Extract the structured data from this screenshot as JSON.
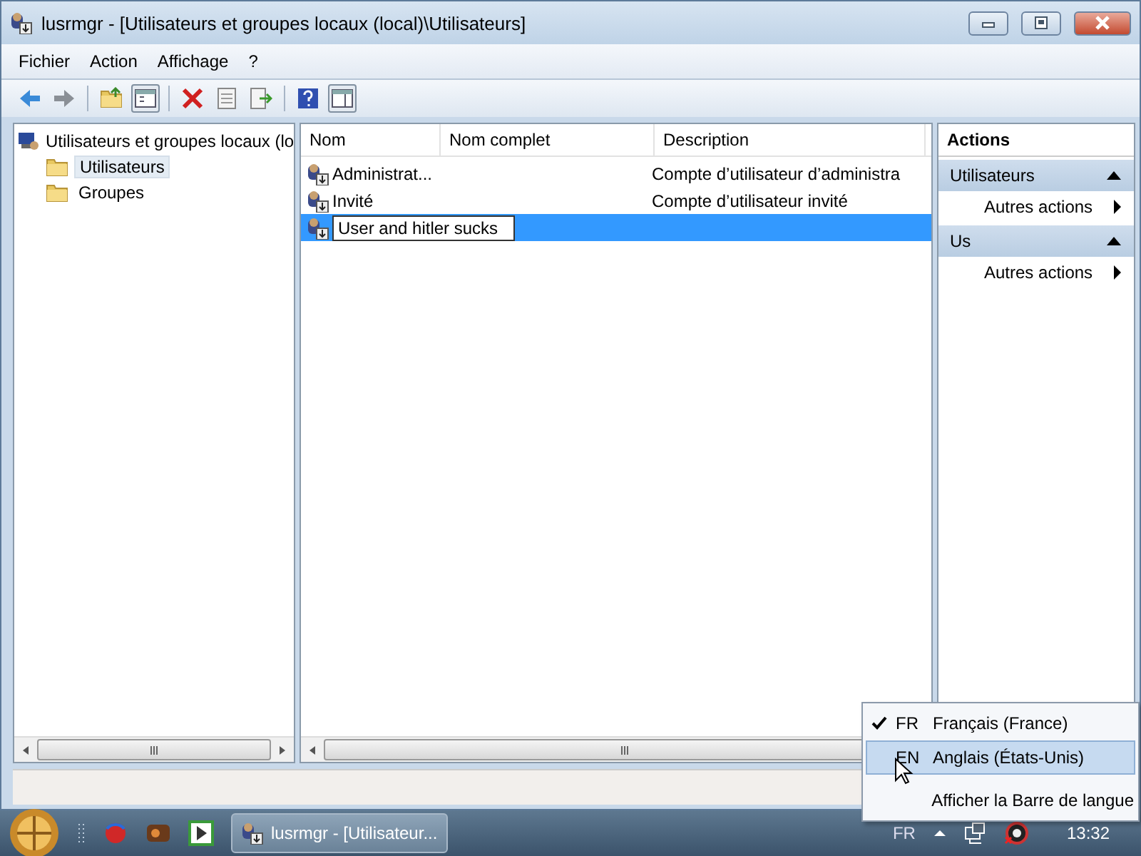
{
  "window": {
    "title": "lusrmgr - [Utilisateurs et groupes locaux (local)\\Utilisateurs]"
  },
  "menu": [
    "Fichier",
    "Action",
    "Affichage",
    "?"
  ],
  "tree": {
    "root": "Utilisateurs et groupes locaux (lo",
    "children": [
      {
        "label": "Utilisateurs",
        "selected": true
      },
      {
        "label": "Groupes",
        "selected": false
      }
    ]
  },
  "table": {
    "columns": [
      "Nom",
      "Nom complet",
      "Description"
    ],
    "rows": [
      {
        "name": "Administrat...",
        "description": "Compte d’utilisateur d’administra",
        "selected": false,
        "editing": false
      },
      {
        "name": "Invité",
        "description": "Compte d’utilisateur invité",
        "selected": false,
        "editing": false
      },
      {
        "name": "User and hitler sucks",
        "selected": true,
        "editing": true
      }
    ]
  },
  "actions": {
    "title": "Actions",
    "sections": [
      {
        "title": "Utilisateurs",
        "items": [
          "Autres actions"
        ]
      },
      {
        "title": "Us",
        "items": [
          "Autres actions"
        ]
      }
    ]
  },
  "language_menu": {
    "items": [
      {
        "kind": "language",
        "code": "FR",
        "label": "Français (France)",
        "checked": true,
        "selected": false
      },
      {
        "kind": "language",
        "code": "EN",
        "label": "Anglais (États-Unis)",
        "checked": false,
        "selected": true
      },
      {
        "kind": "command",
        "label": "Afficher la Barre de langue",
        "selected": false
      }
    ]
  },
  "taskbar": {
    "buttons": [
      {
        "label": "lusrmgr - [Utilisateur...",
        "selected": true
      }
    ],
    "language": "FR",
    "clock": "13:32"
  }
}
